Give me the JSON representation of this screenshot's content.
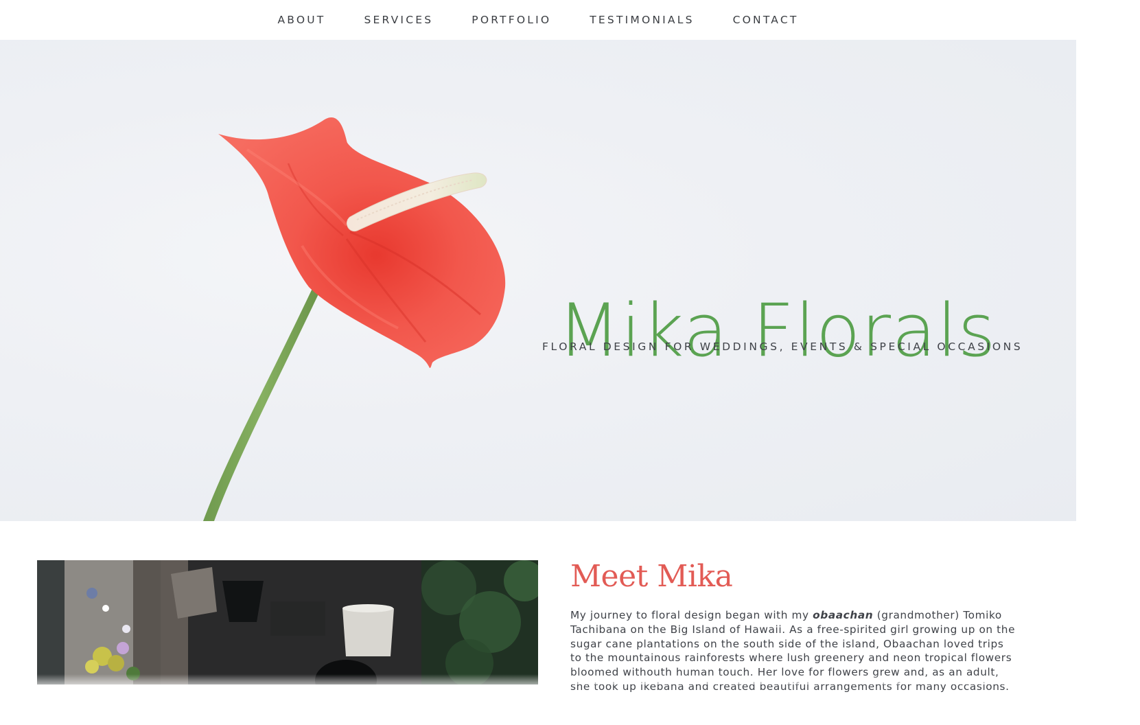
{
  "nav": {
    "items": [
      {
        "label": "ABOUT"
      },
      {
        "label": "SERVICES"
      },
      {
        "label": "PORTFOLIO"
      },
      {
        "label": "TESTIMONIALS"
      },
      {
        "label": "CONTACT"
      }
    ]
  },
  "hero": {
    "title": "Mika Florals",
    "subtitle": "FLORAL DESIGN FOR WEDDINGS, EVENTS & SPECIAL OCCASIONS",
    "image_subject": "anthurium-flower",
    "title_color": "#5ba352",
    "flower_color": "#f0544a"
  },
  "about": {
    "heading": "Meet Mika",
    "heading_color": "#e25b55",
    "body_pre": "My journey to floral design began with my ",
    "body_em": "obaachan",
    "body_post": " (grandmother) Tomiko Tachibana on the Big Island of Hawaii. As a free-spirited girl growing up on the sugar cane plantations on the south side of the island, Obaachan loved trips to the mountainous rainforests where lush greenery and neon tropical flowers bloomed withouth human touch. Her love for flowers grew and, as an adult, she took up ikebana and created beautiful arrangements for many occasions.",
    "photo_subject": "florist-portrait-photo"
  }
}
